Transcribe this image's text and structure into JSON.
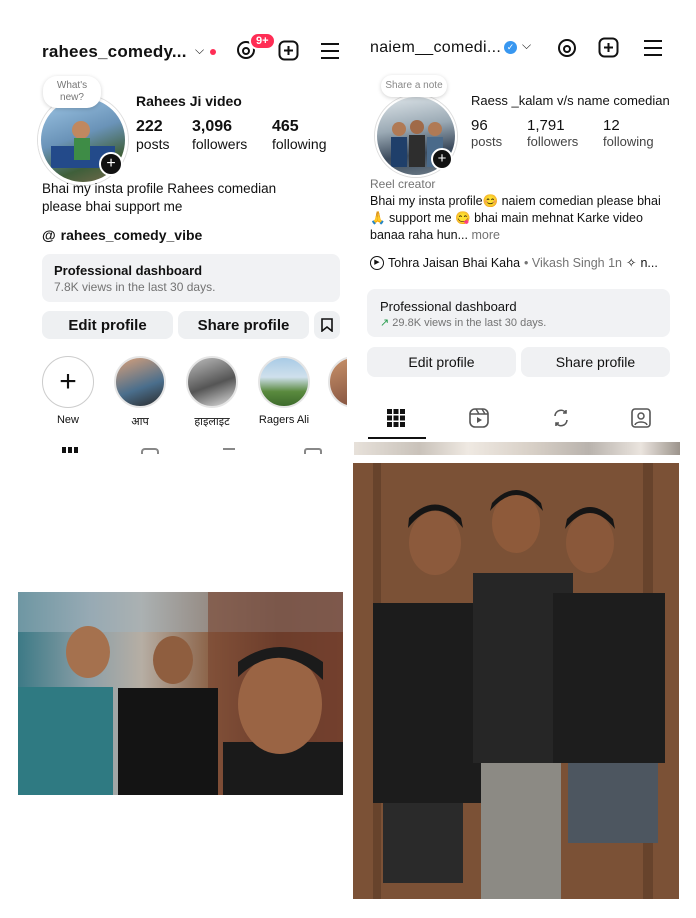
{
  "left": {
    "username": "rahees_comedy...",
    "notif_count": "9+",
    "note_bubble": "What's new?",
    "display_name": "Rahees Ji video",
    "stats": [
      {
        "value": "222",
        "label": "posts"
      },
      {
        "value": "3,096",
        "label": "followers"
      },
      {
        "value": "465",
        "label": "following"
      }
    ],
    "bio_line1": "Bhai my insta profile Rahees comedian",
    "bio_line2": "please bhai support me",
    "threads_handle": "rahees_comedy_vibe",
    "dashboard_title": "Professional dashboard",
    "dashboard_sub": "7.8K views in the last 30 days.",
    "edit_profile": "Edit profile",
    "share_profile": "Share profile",
    "highlights": [
      {
        "label": "New"
      },
      {
        "label": "आप"
      },
      {
        "label": "हाइलाइट"
      },
      {
        "label": "Ragers Ali"
      }
    ]
  },
  "right": {
    "username": "naiem__comedi...",
    "note_bubble": "Share a note",
    "display_name": "Raess _kalam v/s name comedian",
    "stats": [
      {
        "value": "96",
        "label": "posts"
      },
      {
        "value": "1,791",
        "label": "followers"
      },
      {
        "value": "12",
        "label": "following"
      }
    ],
    "category": "Reel creator",
    "bio_line1": "Bhai my insta profile😊 naiem comedian please bhai",
    "bio_line2": "🙏 support me 😋 bhai main mehnat Karke video",
    "bio_line3": "banaa raha hun...",
    "bio_more": "more",
    "music": "Tohra Jaisan Bhai Kaha",
    "music_artist": "• Vikash Singh 1n",
    "music_extra": "n...",
    "dashboard_title": "Professional dashboard",
    "dashboard_sub": "29.8K views in the last 30 days.",
    "edit_profile": "Edit profile",
    "share_profile": "Share profile"
  },
  "colors": {
    "notif_red": "#ff2d55",
    "verified_blue": "#3897f0",
    "divider": "#dbdbdb",
    "button_bg": "#eef0f2",
    "trend_green": "#2a9d4f"
  }
}
